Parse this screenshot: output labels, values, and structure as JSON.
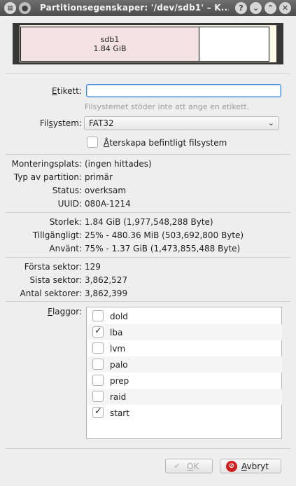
{
  "window": {
    "title": "Partitionsegenskaper: '/dev/sdb1' – K..."
  },
  "graph": {
    "partition_name": "sdb1",
    "partition_size": "1.84 GiB"
  },
  "label_field": {
    "label": "Etikett:",
    "value": "",
    "hint": "Filsystemet stöder inte att ange en etikett."
  },
  "filesystem": {
    "label": "Filsystem:",
    "selected": "FAT32",
    "recreate_label": "Återskapa befintligt filsystem",
    "recreate_checked": false
  },
  "info1": [
    {
      "label": "Monteringsplats:",
      "value": "(ingen hittades)"
    },
    {
      "label": "Typ av partition:",
      "value": "primär"
    },
    {
      "label": "Status:",
      "value": "overksam"
    },
    {
      "label": "UUID:",
      "value": "080A-1214"
    }
  ],
  "info2": [
    {
      "label": "Storlek:",
      "value": "1.84 GiB (1,977,548,288 Byte)"
    },
    {
      "label": "Tillgängligt:",
      "value": "25% - 480.36 MiB (503,692,800 Byte)"
    },
    {
      "label": "Använt:",
      "value": "75% - 1.37 GiB (1,473,855,488 Byte)"
    }
  ],
  "info3": [
    {
      "label": "Första sektor:",
      "value": "129"
    },
    {
      "label": "Sista sektor:",
      "value": "3,862,527"
    },
    {
      "label": "Antal sektorer:",
      "value": "3,862,399"
    }
  ],
  "flags": {
    "label": "Flaggor:",
    "items": [
      {
        "name": "dold",
        "checked": false
      },
      {
        "name": "lba",
        "checked": true
      },
      {
        "name": "lvm",
        "checked": false
      },
      {
        "name": "palo",
        "checked": false
      },
      {
        "name": "prep",
        "checked": false
      },
      {
        "name": "raid",
        "checked": false
      },
      {
        "name": "start",
        "checked": true
      }
    ]
  },
  "buttons": {
    "ok": "OK",
    "cancel": "Avbryt"
  },
  "icons": {
    "app": "app-icon",
    "menu": "window-menu-icon",
    "help": "help-icon",
    "minimize": "minimize-icon",
    "maximize": "maximize-icon",
    "close": "close-icon",
    "ok": "checkmark-icon",
    "cancel": "cancel-icon"
  }
}
